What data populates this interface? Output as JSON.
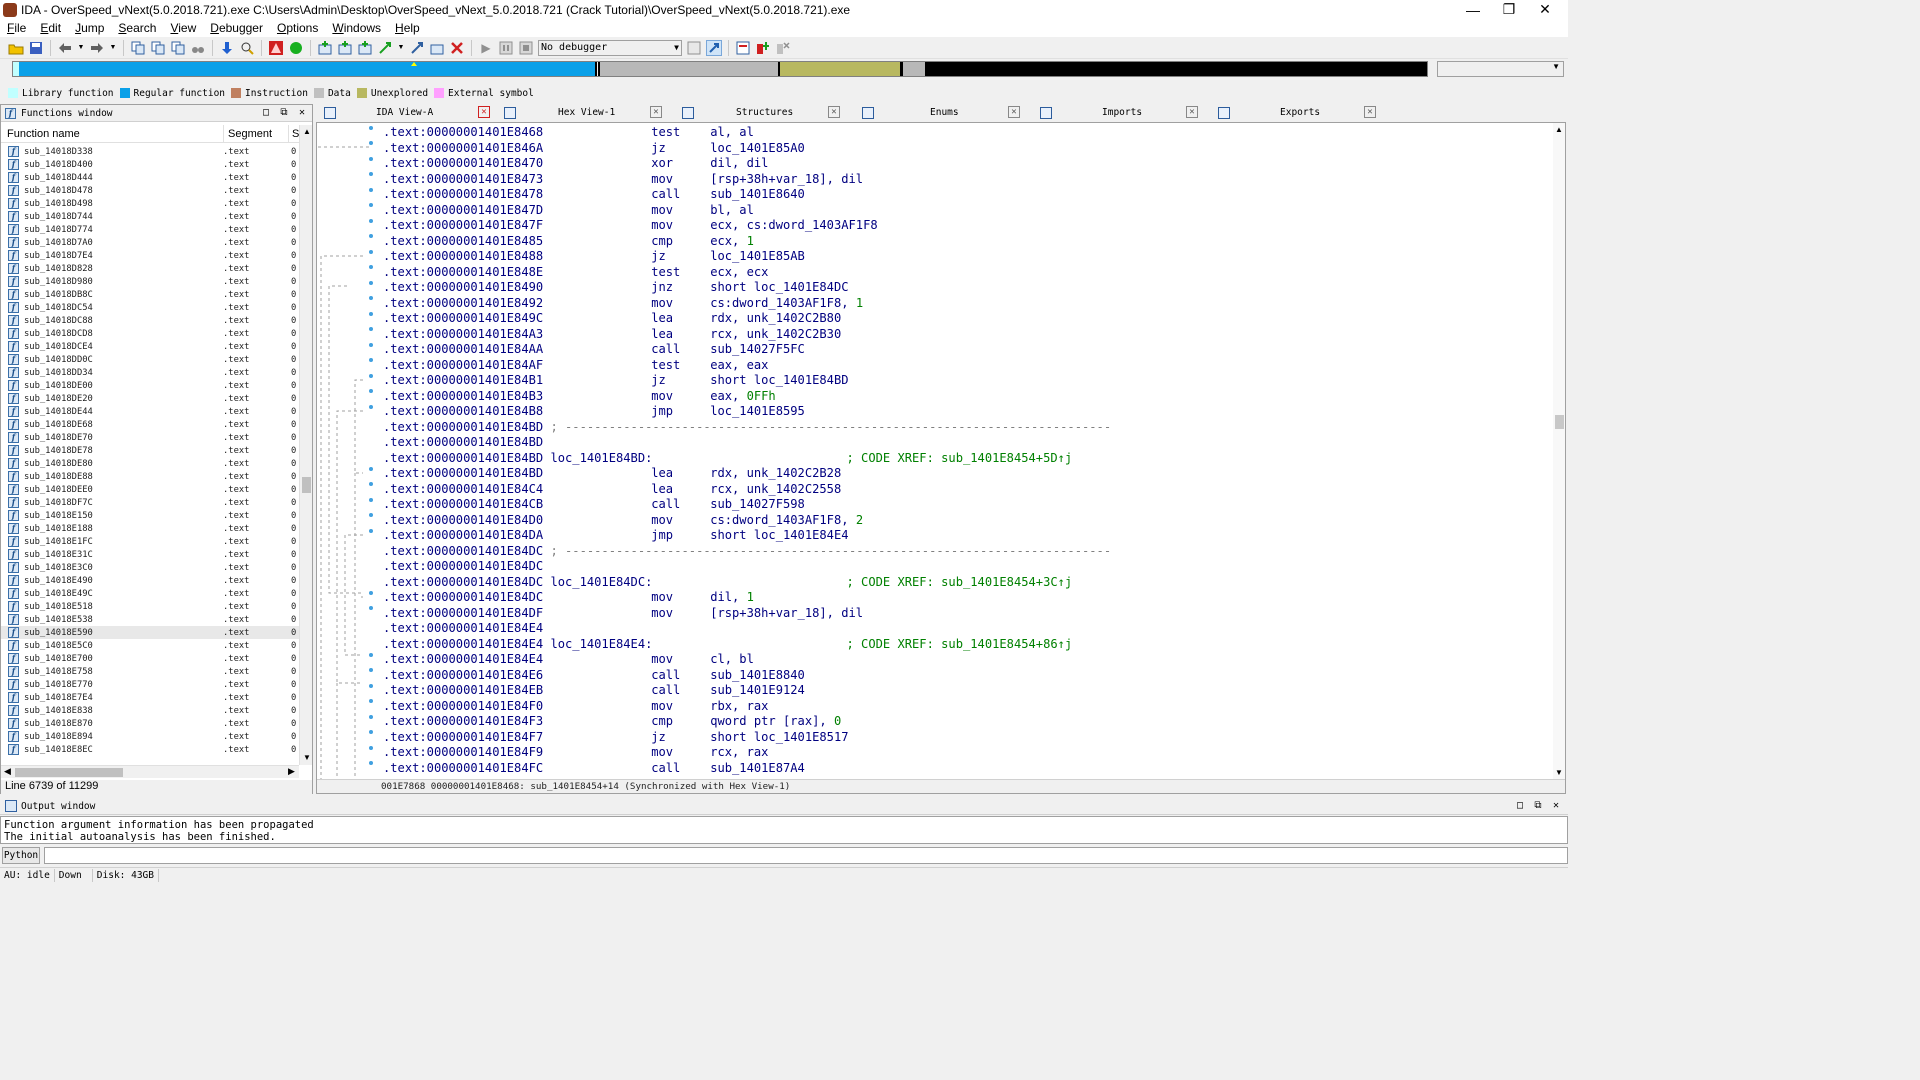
{
  "window": {
    "title": "IDA - OverSpeed_vNext(5.0.2018.721).exe C:\\Users\\Admin\\Desktop\\OverSpeed_vNext_5.0.2018.721 (Crack Tutorial)\\OverSpeed_vNext(5.0.2018.721).exe",
    "minimize_glyph": "—",
    "maximize_glyph": "❐",
    "close_glyph": "✕"
  },
  "menu": [
    "File",
    "Edit",
    "Jump",
    "Search",
    "View",
    "Debugger",
    "Options",
    "Windows",
    "Help"
  ],
  "toolbar": {
    "debugger_value": "No debugger"
  },
  "nav_band": {
    "colors": {
      "library": "#c0ffff",
      "regular": "#0aa0e8",
      "instruction": "#c08060",
      "data": "#b8b8b8",
      "unexplored": "#b8b860",
      "external": "#ffa0ff",
      "undefined": "#000000"
    }
  },
  "legend": [
    {
      "label": "Library function",
      "color": "#c0ffff"
    },
    {
      "label": "Regular function",
      "color": "#0aa0e8"
    },
    {
      "label": "Instruction",
      "color": "#c08060"
    },
    {
      "label": "Data",
      "color": "#c0c0c0"
    },
    {
      "label": "Unexplored",
      "color": "#b8b860"
    },
    {
      "label": "External symbol",
      "color": "#ffa0ff"
    }
  ],
  "functions_window": {
    "title": "Functions window",
    "columns": {
      "name": "Function name",
      "segment": "Segment",
      "start": "S"
    },
    "rows": [
      {
        "name": "sub_14018D338",
        "segment": ".text",
        "start": "0"
      },
      {
        "name": "sub_14018D400",
        "segment": ".text",
        "start": "0"
      },
      {
        "name": "sub_14018D444",
        "segment": ".text",
        "start": "0"
      },
      {
        "name": "sub_14018D478",
        "segment": ".text",
        "start": "0"
      },
      {
        "name": "sub_14018D498",
        "segment": ".text",
        "start": "0"
      },
      {
        "name": "sub_14018D744",
        "segment": ".text",
        "start": "0"
      },
      {
        "name": "sub_14018D774",
        "segment": ".text",
        "start": "0"
      },
      {
        "name": "sub_14018D7A0",
        "segment": ".text",
        "start": "0"
      },
      {
        "name": "sub_14018D7E4",
        "segment": ".text",
        "start": "0"
      },
      {
        "name": "sub_14018D828",
        "segment": ".text",
        "start": "0"
      },
      {
        "name": "sub_14018D980",
        "segment": ".text",
        "start": "0"
      },
      {
        "name": "sub_14018DB8C",
        "segment": ".text",
        "start": "0"
      },
      {
        "name": "sub_14018DC54",
        "segment": ".text",
        "start": "0"
      },
      {
        "name": "sub_14018DC88",
        "segment": ".text",
        "start": "0"
      },
      {
        "name": "sub_14018DCD8",
        "segment": ".text",
        "start": "0"
      },
      {
        "name": "sub_14018DCE4",
        "segment": ".text",
        "start": "0"
      },
      {
        "name": "sub_14018DD0C",
        "segment": ".text",
        "start": "0"
      },
      {
        "name": "sub_14018DD34",
        "segment": ".text",
        "start": "0"
      },
      {
        "name": "sub_14018DE00",
        "segment": ".text",
        "start": "0"
      },
      {
        "name": "sub_14018DE20",
        "segment": ".text",
        "start": "0"
      },
      {
        "name": "sub_14018DE44",
        "segment": ".text",
        "start": "0"
      },
      {
        "name": "sub_14018DE68",
        "segment": ".text",
        "start": "0"
      },
      {
        "name": "sub_14018DE70",
        "segment": ".text",
        "start": "0"
      },
      {
        "name": "sub_14018DE78",
        "segment": ".text",
        "start": "0"
      },
      {
        "name": "sub_14018DE80",
        "segment": ".text",
        "start": "0"
      },
      {
        "name": "sub_14018DE88",
        "segment": ".text",
        "start": "0"
      },
      {
        "name": "sub_14018DEE0",
        "segment": ".text",
        "start": "0"
      },
      {
        "name": "sub_14018DF7C",
        "segment": ".text",
        "start": "0"
      },
      {
        "name": "sub_14018E150",
        "segment": ".text",
        "start": "0"
      },
      {
        "name": "sub_14018E188",
        "segment": ".text",
        "start": "0"
      },
      {
        "name": "sub_14018E1FC",
        "segment": ".text",
        "start": "0"
      },
      {
        "name": "sub_14018E31C",
        "segment": ".text",
        "start": "0"
      },
      {
        "name": "sub_14018E3C0",
        "segment": ".text",
        "start": "0"
      },
      {
        "name": "sub_14018E490",
        "segment": ".text",
        "start": "0"
      },
      {
        "name": "sub_14018E49C",
        "segment": ".text",
        "start": "0"
      },
      {
        "name": "sub_14018E518",
        "segment": ".text",
        "start": "0"
      },
      {
        "name": "sub_14018E538",
        "segment": ".text",
        "start": "0"
      },
      {
        "name": "sub_14018E590",
        "segment": ".text",
        "start": "0"
      },
      {
        "name": "sub_14018E5C0",
        "segment": ".text",
        "start": "0"
      },
      {
        "name": "sub_14018E700",
        "segment": ".text",
        "start": "0"
      },
      {
        "name": "sub_14018E758",
        "segment": ".text",
        "start": "0"
      },
      {
        "name": "sub_14018E770",
        "segment": ".text",
        "start": "0"
      },
      {
        "name": "sub_14018E7E4",
        "segment": ".text",
        "start": "0"
      },
      {
        "name": "sub_14018E838",
        "segment": ".text",
        "start": "0"
      },
      {
        "name": "sub_14018E870",
        "segment": ".text",
        "start": "0"
      },
      {
        "name": "sub_14018E894",
        "segment": ".text",
        "start": "0"
      },
      {
        "name": "sub_14018E8EC",
        "segment": ".text",
        "start": "0"
      }
    ],
    "selected_index": 37,
    "footer": "Line 6739 of 11299"
  },
  "tabs": [
    {
      "label": "IDA View-A",
      "active": true
    },
    {
      "label": "Hex View-1",
      "active": false
    },
    {
      "label": "Structures",
      "active": false
    },
    {
      "label": "Enums",
      "active": false
    },
    {
      "label": "Imports",
      "active": false
    },
    {
      "label": "Exports",
      "active": false
    }
  ],
  "disasm": {
    "lines": [
      {
        "addr": ".text:00000001401E8468",
        "label": "",
        "mnem": "test",
        "ops": "al, al",
        "num": "",
        "comment": ""
      },
      {
        "addr": ".text:00000001401E846A",
        "label": "",
        "mnem": "jz",
        "ops": "loc_1401E85A0",
        "num": "",
        "comment": ""
      },
      {
        "addr": ".text:00000001401E8470",
        "label": "",
        "mnem": "xor",
        "ops": "dil, dil",
        "num": "",
        "comment": ""
      },
      {
        "addr": ".text:00000001401E8473",
        "label": "",
        "mnem": "mov",
        "ops": "[rsp+38h+var_18], dil",
        "num": "",
        "comment": ""
      },
      {
        "addr": ".text:00000001401E8478",
        "label": "",
        "mnem": "call",
        "ops": "sub_1401E8640",
        "num": "",
        "comment": ""
      },
      {
        "addr": ".text:00000001401E847D",
        "label": "",
        "mnem": "mov",
        "ops": "bl, al",
        "num": "",
        "comment": ""
      },
      {
        "addr": ".text:00000001401E847F",
        "label": "",
        "mnem": "mov",
        "ops": "ecx, cs:dword_1403AF1F8",
        "num": "",
        "comment": ""
      },
      {
        "addr": ".text:00000001401E8485",
        "label": "",
        "mnem": "cmp",
        "ops": "ecx, ",
        "num": "1",
        "comment": ""
      },
      {
        "addr": ".text:00000001401E8488",
        "label": "",
        "mnem": "jz",
        "ops": "loc_1401E85AB",
        "num": "",
        "comment": ""
      },
      {
        "addr": ".text:00000001401E848E",
        "label": "",
        "mnem": "test",
        "ops": "ecx, ecx",
        "num": "",
        "comment": ""
      },
      {
        "addr": ".text:00000001401E8490",
        "label": "",
        "mnem": "jnz",
        "ops": "short loc_1401E84DC",
        "num": "",
        "comment": ""
      },
      {
        "addr": ".text:00000001401E8492",
        "label": "",
        "mnem": "mov",
        "ops": "cs:dword_1403AF1F8, ",
        "num": "1",
        "comment": ""
      },
      {
        "addr": ".text:00000001401E849C",
        "label": "",
        "mnem": "lea",
        "ops": "rdx, unk_1402C2B80",
        "num": "",
        "comment": ""
      },
      {
        "addr": ".text:00000001401E84A3",
        "label": "",
        "mnem": "lea",
        "ops": "rcx, unk_1402C2B30",
        "num": "",
        "comment": ""
      },
      {
        "addr": ".text:00000001401E84AA",
        "label": "",
        "mnem": "call",
        "ops": "sub_14027F5FC",
        "num": "",
        "comment": ""
      },
      {
        "addr": ".text:00000001401E84AF",
        "label": "",
        "mnem": "test",
        "ops": "eax, eax",
        "num": "",
        "comment": ""
      },
      {
        "addr": ".text:00000001401E84B1",
        "label": "",
        "mnem": "jz",
        "ops": "short loc_1401E84BD",
        "num": "",
        "comment": ""
      },
      {
        "addr": ".text:00000001401E84B3",
        "label": "",
        "mnem": "mov",
        "ops": "eax, ",
        "num": "0FFh",
        "comment": ""
      },
      {
        "addr": ".text:00000001401E84B8",
        "label": "",
        "mnem": "jmp",
        "ops": "loc_1401E8595",
        "num": "",
        "comment": ""
      },
      {
        "addr": ".text:00000001401E84BD",
        "label": "",
        "mnem": "",
        "ops": "",
        "num": "",
        "comment": "",
        "sep": " ; ---------------------------------------------------------------------------"
      },
      {
        "addr": ".text:00000001401E84BD",
        "label": "",
        "mnem": "",
        "ops": "",
        "num": "",
        "comment": ""
      },
      {
        "addr": ".text:00000001401E84BD",
        "label": "loc_1401E84BD:",
        "mnem": "",
        "ops": "",
        "num": "",
        "comment": "; CODE XREF: sub_1401E8454+5D↑j"
      },
      {
        "addr": ".text:00000001401E84BD",
        "label": "",
        "mnem": "lea",
        "ops": "rdx, unk_1402C2B28",
        "num": "",
        "comment": ""
      },
      {
        "addr": ".text:00000001401E84C4",
        "label": "",
        "mnem": "lea",
        "ops": "rcx, unk_1402C2558",
        "num": "",
        "comment": ""
      },
      {
        "addr": ".text:00000001401E84CB",
        "label": "",
        "mnem": "call",
        "ops": "sub_14027F598",
        "num": "",
        "comment": ""
      },
      {
        "addr": ".text:00000001401E84D0",
        "label": "",
        "mnem": "mov",
        "ops": "cs:dword_1403AF1F8, ",
        "num": "2",
        "comment": ""
      },
      {
        "addr": ".text:00000001401E84DA",
        "label": "",
        "mnem": "jmp",
        "ops": "short loc_1401E84E4",
        "num": "",
        "comment": ""
      },
      {
        "addr": ".text:00000001401E84DC",
        "label": "",
        "mnem": "",
        "ops": "",
        "num": "",
        "comment": "",
        "sep": " ; ---------------------------------------------------------------------------"
      },
      {
        "addr": ".text:00000001401E84DC",
        "label": "",
        "mnem": "",
        "ops": "",
        "num": "",
        "comment": ""
      },
      {
        "addr": ".text:00000001401E84DC",
        "label": "loc_1401E84DC:",
        "mnem": "",
        "ops": "",
        "num": "",
        "comment": "; CODE XREF: sub_1401E8454+3C↑j"
      },
      {
        "addr": ".text:00000001401E84DC",
        "label": "",
        "mnem": "mov",
        "ops": "dil, ",
        "num": "1",
        "comment": ""
      },
      {
        "addr": ".text:00000001401E84DF",
        "label": "",
        "mnem": "mov",
        "ops": "[rsp+38h+var_18], dil",
        "num": "",
        "comment": ""
      },
      {
        "addr": ".text:00000001401E84E4",
        "label": "",
        "mnem": "",
        "ops": "",
        "num": "",
        "comment": ""
      },
      {
        "addr": ".text:00000001401E84E4",
        "label": "loc_1401E84E4:",
        "mnem": "",
        "ops": "",
        "num": "",
        "comment": "; CODE XREF: sub_1401E8454+86↑j"
      },
      {
        "addr": ".text:00000001401E84E4",
        "label": "",
        "mnem": "mov",
        "ops": "cl, bl",
        "num": "",
        "comment": ""
      },
      {
        "addr": ".text:00000001401E84E6",
        "label": "",
        "mnem": "call",
        "ops": "sub_1401E8840",
        "num": "",
        "comment": ""
      },
      {
        "addr": ".text:00000001401E84EB",
        "label": "",
        "mnem": "call",
        "ops": "sub_1401E9124",
        "num": "",
        "comment": ""
      },
      {
        "addr": ".text:00000001401E84F0",
        "label": "",
        "mnem": "mov",
        "ops": "rbx, rax",
        "num": "",
        "comment": ""
      },
      {
        "addr": ".text:00000001401E84F3",
        "label": "",
        "mnem": "cmp",
        "ops": "qword ptr [rax], ",
        "num": "0",
        "comment": ""
      },
      {
        "addr": ".text:00000001401E84F7",
        "label": "",
        "mnem": "jz",
        "ops": "short loc_1401E8517",
        "num": "",
        "comment": ""
      },
      {
        "addr": ".text:00000001401E84F9",
        "label": "",
        "mnem": "mov",
        "ops": "rcx, rax",
        "num": "",
        "comment": ""
      },
      {
        "addr": ".text:00000001401E84FC",
        "label": "",
        "mnem": "call",
        "ops": "sub_1401E87A4",
        "num": "",
        "comment": ""
      }
    ],
    "status": "001E7868 00000001401E8468: sub_1401E8454+14 (Synchronized with Hex View-1)"
  },
  "output_window": {
    "title": "Output window",
    "lines": [
      "Function argument information has been propagated",
      "The initial autoanalysis has been finished."
    ]
  },
  "python_button": "Python",
  "statusbar": {
    "au": "AU:",
    "au_state": "idle",
    "direction": "Down",
    "disk": "Disk: 43GB"
  }
}
